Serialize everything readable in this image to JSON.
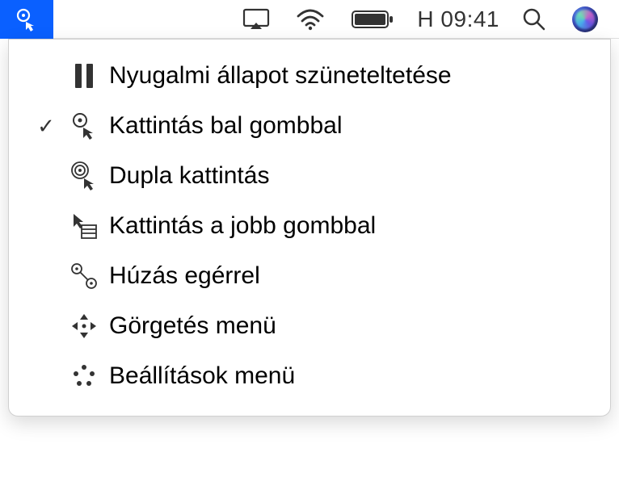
{
  "menubar": {
    "time": "H 09:41",
    "icons": {
      "dwell": "dwell-click-icon",
      "airplay": "airplay-icon",
      "wifi": "wifi-icon",
      "battery": "battery-icon",
      "search": "search-icon",
      "siri": "siri-icon"
    }
  },
  "dropdown": {
    "items": [
      {
        "label": "Nyugalmi állapot szüneteltetése",
        "icon": "pause-icon",
        "checked": false
      },
      {
        "label": "Kattintás bal gombbal",
        "icon": "left-click-icon",
        "checked": true
      },
      {
        "label": "Dupla kattintás",
        "icon": "double-click-icon",
        "checked": false
      },
      {
        "label": "Kattintás a jobb gombbal",
        "icon": "right-click-icon",
        "checked": false
      },
      {
        "label": "Húzás egérrel",
        "icon": "drag-icon",
        "checked": false
      },
      {
        "label": "Görgetés menü",
        "icon": "scroll-icon",
        "checked": false
      },
      {
        "label": "Beállítások menü",
        "icon": "options-icon",
        "checked": false
      }
    ]
  }
}
